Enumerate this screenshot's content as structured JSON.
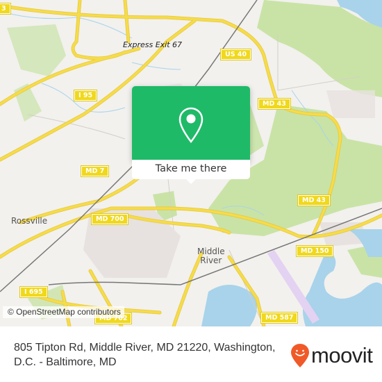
{
  "map": {
    "attribution": "© OpenStreetMap contributors",
    "colors": {
      "land": "#f2f1ee",
      "park": "#c9e3a6",
      "water": "#a8d3ea",
      "road": "#f5dc4a",
      "rail": "#777777",
      "residential": "#e7e2df",
      "airport_runway": "#e3d2f1"
    },
    "labels": {
      "express_exit": "Express Exit 67",
      "rossville": "Rossville",
      "middle_river_line1": "Middle",
      "middle_river_line2": "River"
    },
    "shields": {
      "i95": "I 95",
      "us40": "US 40",
      "md43_north": "MD 43",
      "md43_south": "MD 43",
      "md7": "MD 7",
      "md700": "MD 700",
      "md150": "MD 150",
      "i695": "I 695",
      "md702": "MD 702",
      "md587": "MD 587",
      "partial_left": "3"
    }
  },
  "popup": {
    "icon": "map-pin-icon",
    "button_label": "Take me there",
    "color": "#1fba68"
  },
  "footer": {
    "address": "805 Tipton Rd, Middle River, MD 21220, Washington, D.C. - Baltimore, MD",
    "logo_text": "moovit",
    "logo_color": "#f05a28"
  }
}
